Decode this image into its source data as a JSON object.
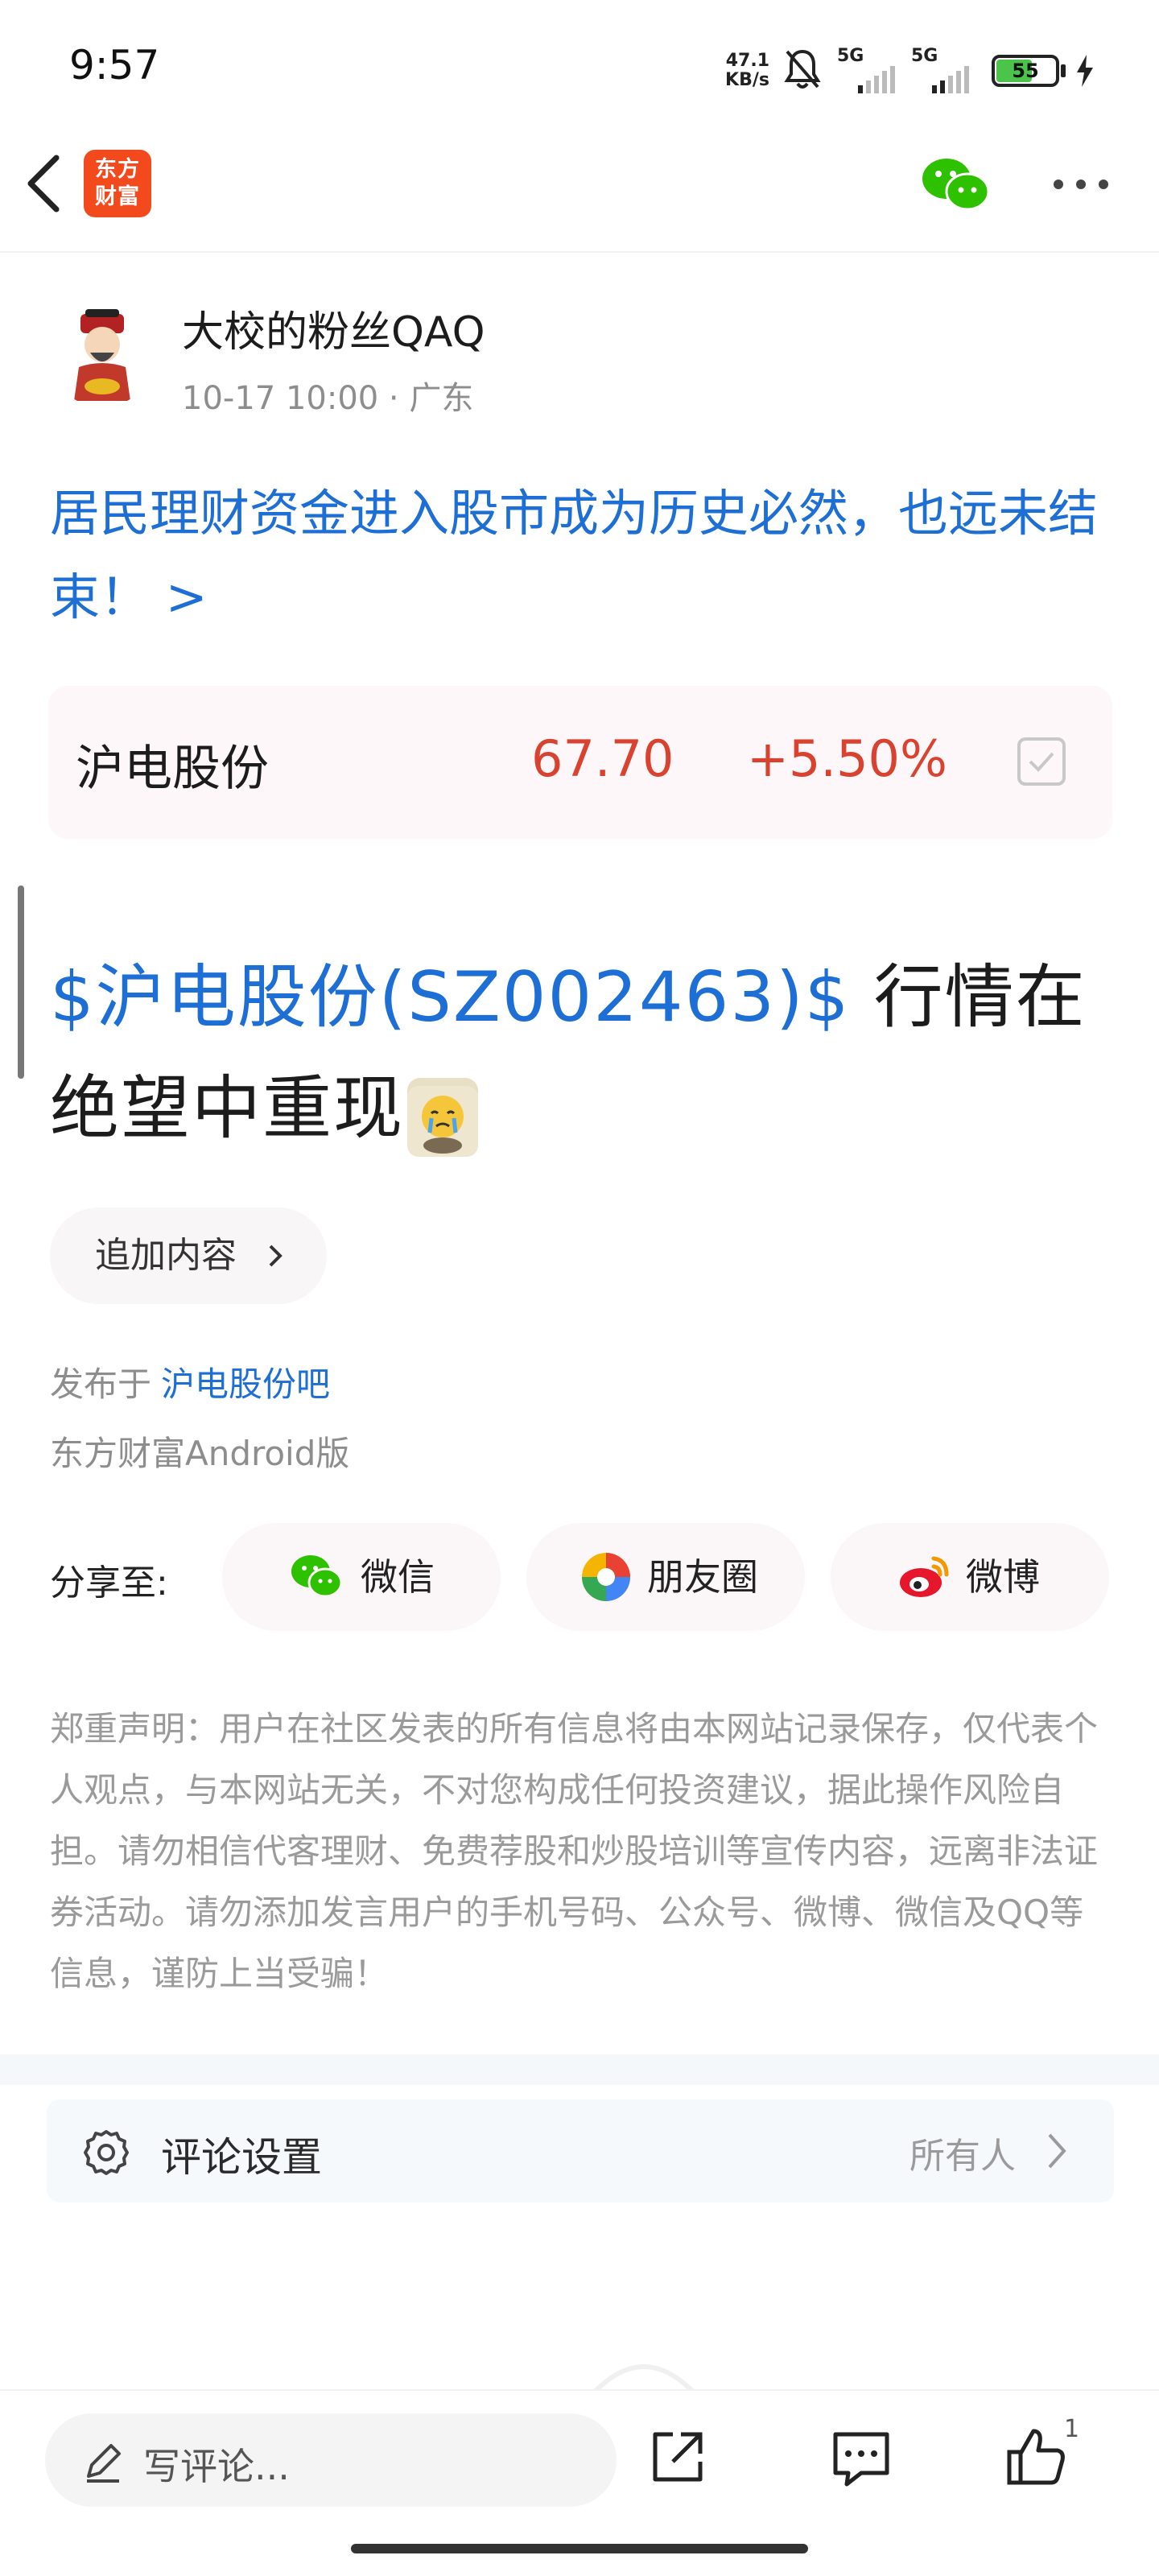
{
  "status_bar": {
    "time": "9:57",
    "net_speed_top": "47.1",
    "net_speed_bottom": "KB/s",
    "sim1": "5G",
    "sim2": "5G",
    "battery": "55"
  },
  "nav": {
    "logo_line1": "东方",
    "logo_line2": "财富"
  },
  "post": {
    "author": "大校的粉丝QAQ",
    "meta": "10-17 10:00 · 广东",
    "topic": "居民理财资金进入股市成为历史必然，也远未结束！ >",
    "stock": {
      "name": "沪电股份",
      "price": "67.70",
      "change": "+5.50%",
      "color": "#d9422f"
    },
    "tag": "$沪电股份(SZ002463)$",
    "body_text": " 行情在绝望中重现",
    "append_label": "追加内容",
    "published_prefix": "发布于",
    "forum_link": "沪电股份吧",
    "client": "东方财富Android版"
  },
  "share": {
    "label": "分享至:",
    "wechat": "微信",
    "moments": "朋友圈",
    "weibo": "微博"
  },
  "disclaimer": "郑重声明：用户在社区发表的所有信息将由本网站记录保存，仅代表个人观点，与本网站无关，不对您构成任何投资建议，据此操作风险自担。请勿相信代客理财、免费荐股和炒股培训等宣传内容，远离非法证券活动。请勿添加发言用户的手机号码、公众号、微博、微信及QQ等信息，谨防上当受骗！",
  "comment_settings": {
    "label": "评论设置",
    "value": "所有人"
  },
  "bottom_bar": {
    "placeholder": "写评论...",
    "like_count": "1"
  },
  "colors": {
    "link_blue": "#1d6fd6",
    "brand_orange": "#f24a1c",
    "rise_red": "#d9422f",
    "wechat_green": "#2dc100"
  }
}
